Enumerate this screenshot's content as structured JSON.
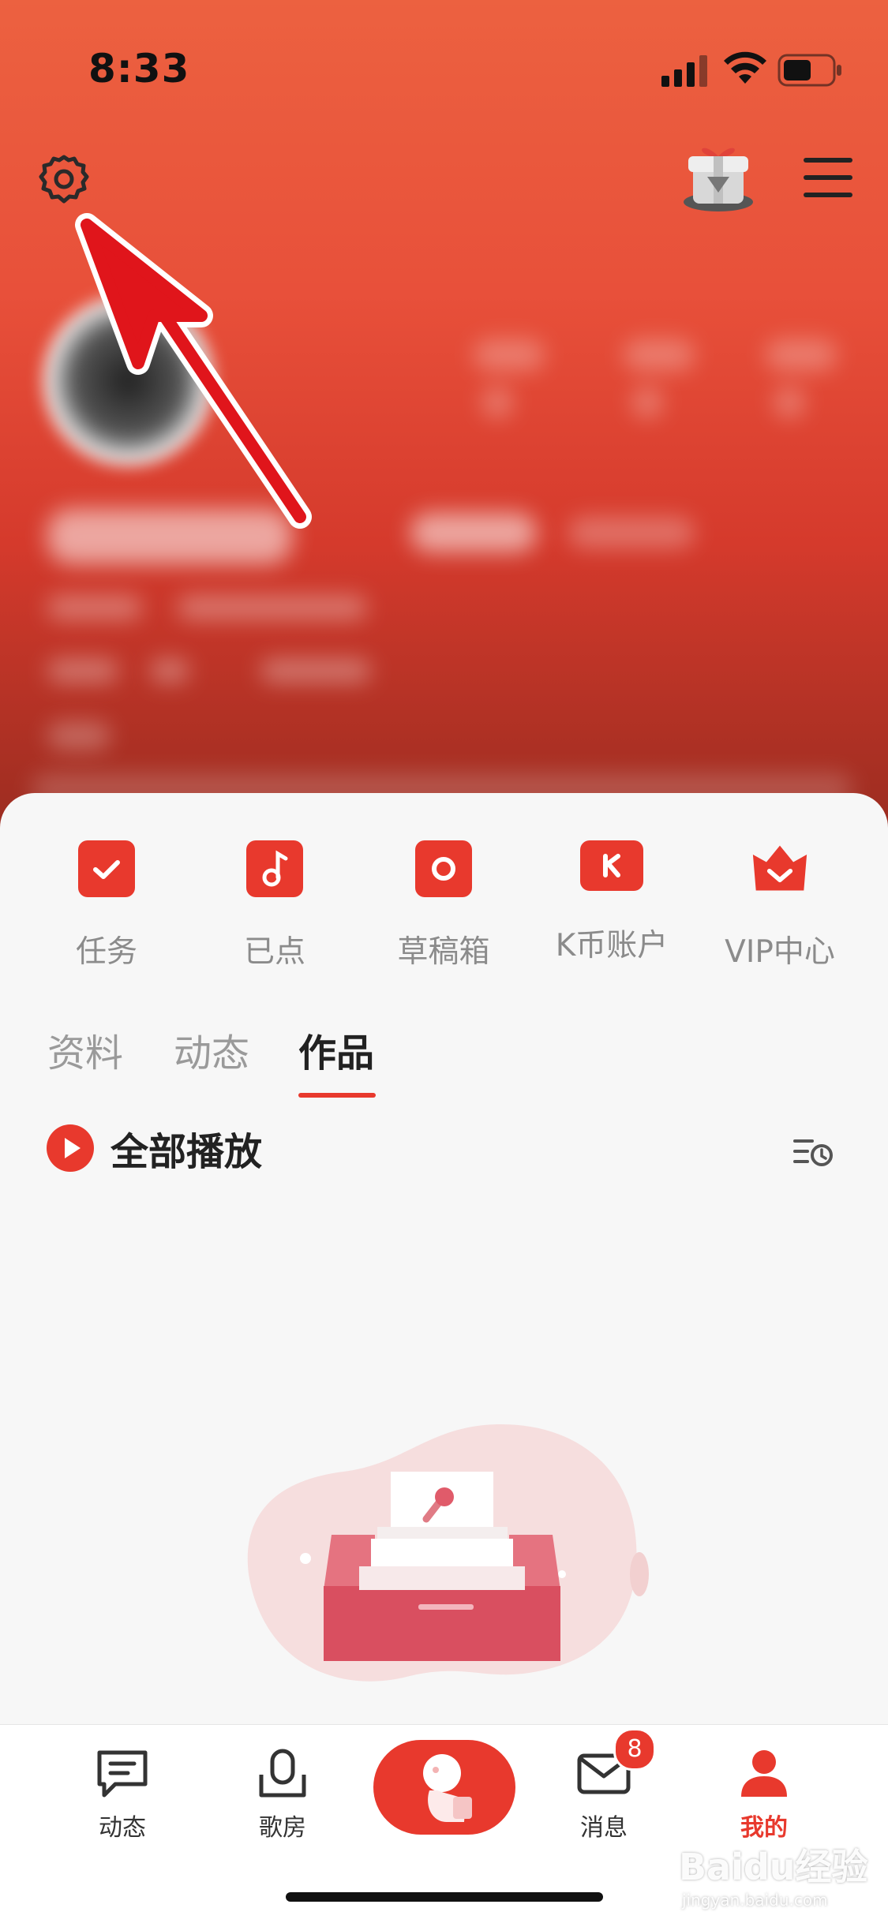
{
  "status_bar": {
    "time": "8:33"
  },
  "quick_actions": [
    {
      "label": "任务",
      "icon": "calendar-check-icon"
    },
    {
      "label": "已点",
      "icon": "music-note-icon"
    },
    {
      "label": "草稿箱",
      "icon": "draft-box-icon"
    },
    {
      "label": "K币账户",
      "icon": "k-coin-wallet-icon"
    },
    {
      "label": "VIP中心",
      "icon": "vip-crown-icon"
    }
  ],
  "tabs": [
    {
      "label": "资料",
      "active": false
    },
    {
      "label": "动态",
      "active": false
    },
    {
      "label": "作品",
      "active": true
    }
  ],
  "play_all": {
    "label": "全部播放"
  },
  "bottom_nav": [
    {
      "label": "动态",
      "icon": "chat-icon"
    },
    {
      "label": "歌房",
      "icon": "microphone-icon"
    },
    {
      "label": "",
      "icon": "sing-mascot-icon"
    },
    {
      "label": "消息",
      "icon": "mail-icon",
      "badge": "8"
    },
    {
      "label": "我的",
      "icon": "person-icon",
      "active": true
    }
  ],
  "watermark": {
    "text": "Baidu经验",
    "sub": "jingyan.baidu.com"
  },
  "colors": {
    "accent": "#e8392d",
    "header_top": "#ec6140",
    "header_bottom": "#9a2c20"
  }
}
